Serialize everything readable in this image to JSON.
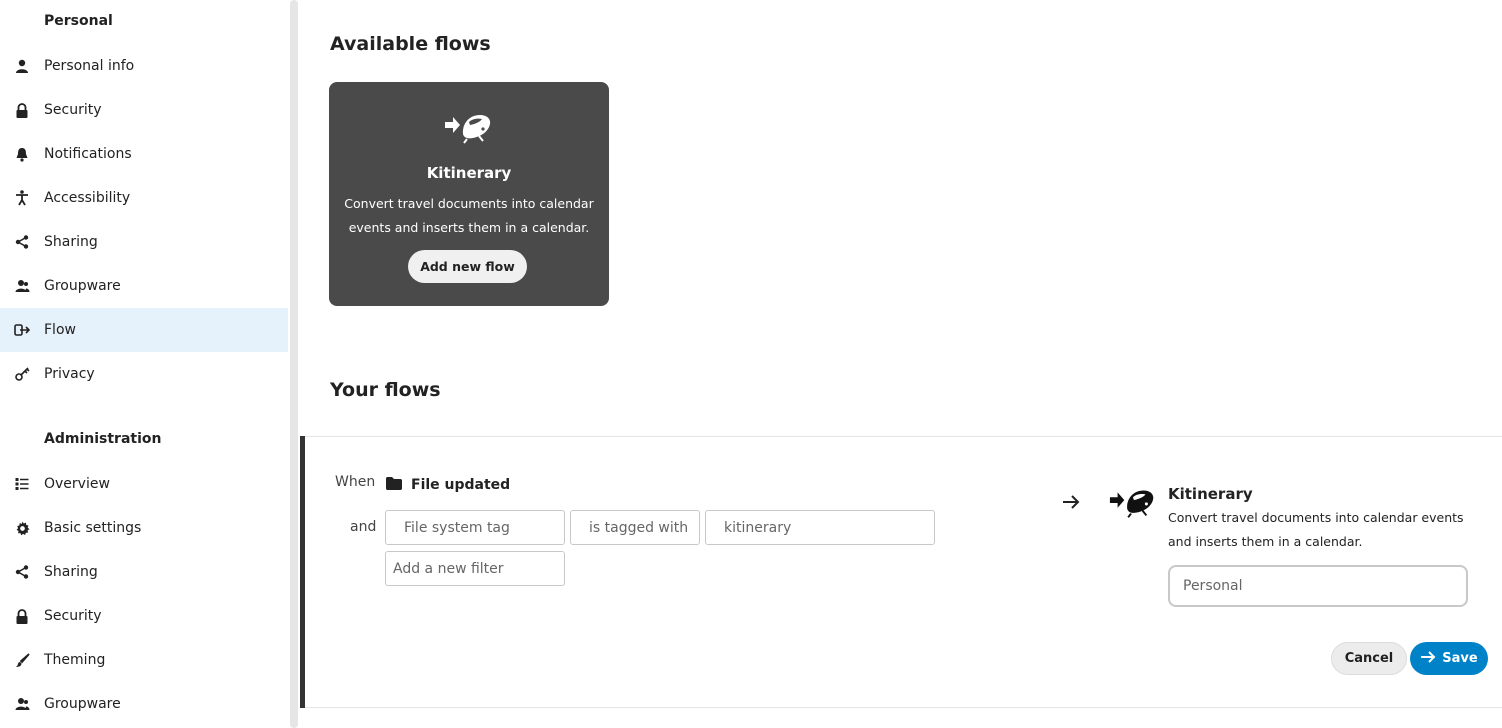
{
  "sidebar": {
    "personal_title": "Personal",
    "personal_items": [
      {
        "label": "Personal info",
        "icon": "person-icon"
      },
      {
        "label": "Security",
        "icon": "lock-icon"
      },
      {
        "label": "Notifications",
        "icon": "bell-icon"
      },
      {
        "label": "Accessibility",
        "icon": "accessibility-icon"
      },
      {
        "label": "Sharing",
        "icon": "share-icon"
      },
      {
        "label": "Groupware",
        "icon": "group-icon"
      },
      {
        "label": "Flow",
        "icon": "flow-icon",
        "active": true
      },
      {
        "label": "Privacy",
        "icon": "key-icon"
      }
    ],
    "admin_title": "Administration",
    "admin_items": [
      {
        "label": "Overview",
        "icon": "list-icon"
      },
      {
        "label": "Basic settings",
        "icon": "gear-icon"
      },
      {
        "label": "Sharing",
        "icon": "share-icon"
      },
      {
        "label": "Security",
        "icon": "lock-icon"
      },
      {
        "label": "Theming",
        "icon": "paintbrush-icon"
      },
      {
        "label": "Groupware",
        "icon": "group-icon"
      }
    ]
  },
  "available": {
    "title": "Available flows",
    "card": {
      "title": "Kitinerary",
      "description": "Convert travel documents into calendar events and inserts them in a calendar.",
      "button": "Add new flow",
      "icon": "kitinerary-train-icon"
    }
  },
  "your_flows": {
    "title": "Your flows",
    "rule": {
      "when_label": "When",
      "event_label": "File updated",
      "event_icon": "folder-icon",
      "and_label": "and",
      "check_field": "File system tag",
      "check_operator": "is tagged with",
      "check_value": "kitinerary",
      "add_filter_placeholder": "Add a new filter",
      "operation": {
        "title": "Kitinerary",
        "description": "Convert travel documents into calendar events and inserts them in a calendar.",
        "calendar_value": "Personal"
      },
      "cancel_label": "Cancel",
      "save_label": "Save"
    }
  },
  "colors": {
    "accent": "#0082c9",
    "active_nav": "#e5f1fb",
    "card_bg": "#4a4a4a"
  }
}
